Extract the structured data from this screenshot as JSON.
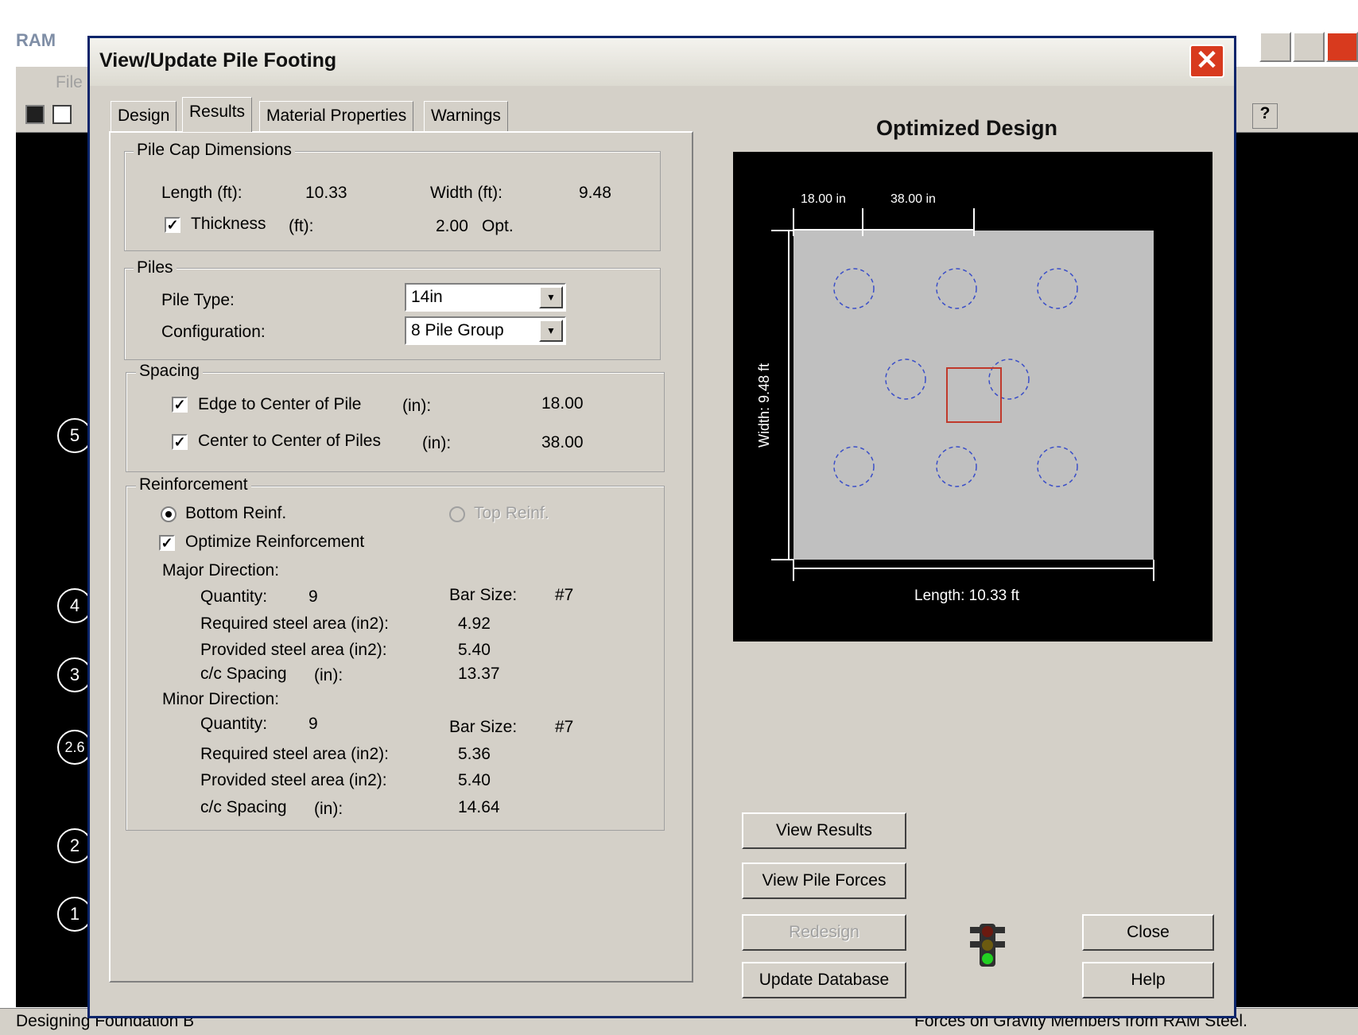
{
  "app": {
    "title": "RAM",
    "menu_file": "File",
    "grid_labels": [
      "5",
      "4",
      "3",
      "2.6",
      "2",
      "1"
    ],
    "status_left": "Designing Foundation B",
    "status_right": "Forces on Gravity Members from RAM Steel."
  },
  "dialog": {
    "title": "View/Update Pile Footing",
    "tabs": [
      "Design",
      "Results",
      "Material Properties",
      "Warnings"
    ],
    "active_tab": "Results"
  },
  "pile_cap": {
    "legend": "Pile Cap Dimensions",
    "length_label": "Length (ft):",
    "length_value": "10.33",
    "width_label": "Width (ft):",
    "width_value": "9.48",
    "thickness_label": "Thickness",
    "thickness_unit": "(ft):",
    "thickness_value": "2.00",
    "thickness_opt": "Opt.",
    "thickness_checked": true
  },
  "piles": {
    "legend": "Piles",
    "type_label": "Pile Type:",
    "type_value": "14in",
    "config_label": "Configuration:",
    "config_value": "8 Pile Group"
  },
  "spacing": {
    "legend": "Spacing",
    "edge_label": "Edge to Center of Pile",
    "edge_unit": "(in):",
    "edge_value": "18.00",
    "center_label": "Center to Center of Piles",
    "center_unit": "(in):",
    "center_value": "38.00"
  },
  "reinforcement": {
    "legend": "Reinforcement",
    "bottom_label": "Bottom Reinf.",
    "top_label": "Top Reinf.",
    "optimize_label": "Optimize Reinforcement",
    "major": {
      "heading": "Major Direction:",
      "quantity_label": "Quantity:",
      "quantity": "9",
      "bar_size_label": "Bar Size:",
      "bar_size": "#7",
      "req_label": "Required steel area (in2):",
      "req": "4.92",
      "prov_label": "Provided steel area (in2):",
      "prov": "5.40",
      "spacing_label": "c/c Spacing",
      "spacing_unit": "(in):",
      "spacing": "13.37"
    },
    "minor": {
      "heading": "Minor Direction:",
      "quantity_label": "Quantity:",
      "quantity": "9",
      "bar_size_label": "Bar Size:",
      "bar_size": "#7",
      "req_label": "Required steel area (in2):",
      "req": "5.36",
      "prov_label": "Provided steel area (in2):",
      "prov": "5.40",
      "spacing_label": "c/c Spacing",
      "spacing_unit": "(in):",
      "spacing": "14.64"
    }
  },
  "drawing": {
    "title": "Optimized Design",
    "dim_edge": "18.00 in",
    "dim_center": "38.00 in",
    "width_label": "Width: 9.48 ft",
    "length_label": "Length: 10.33 ft",
    "pile_color": "#3a4ec8",
    "column_color": "#c0392b",
    "cap_color": "#c0c0c0"
  },
  "buttons": {
    "view_results": "View Results",
    "view_pile_forces": "View Pile Forces",
    "redesign": "Redesign",
    "update_database": "Update Database",
    "close": "Close",
    "help": "Help"
  }
}
